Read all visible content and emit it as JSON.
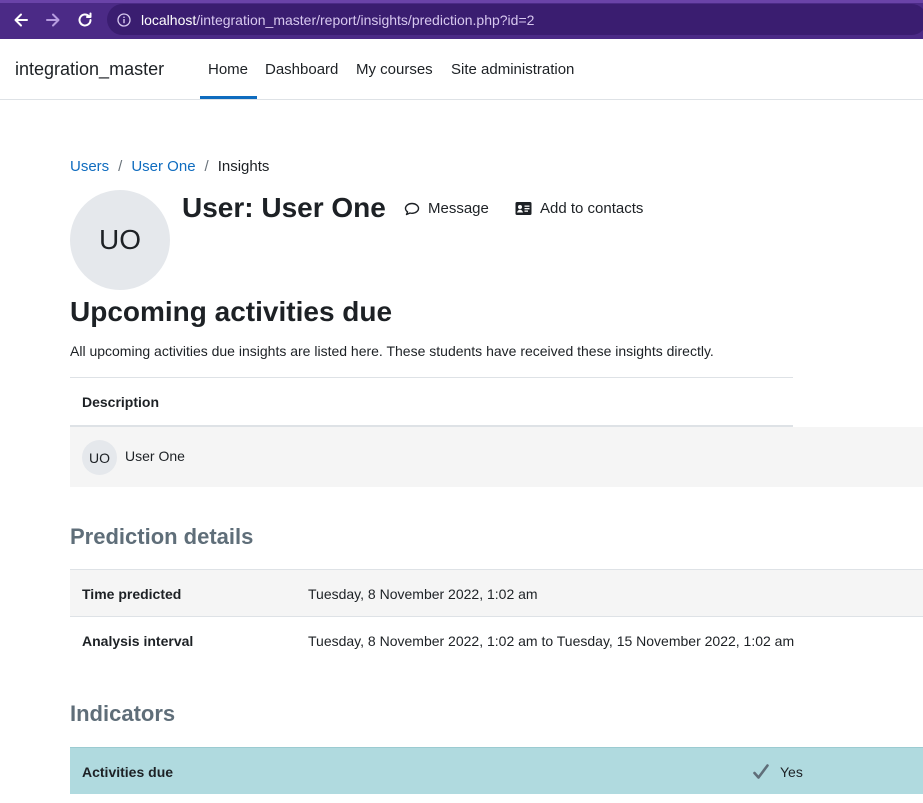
{
  "browser": {
    "url_host": "localhost",
    "url_path": "/integration_master/report/insights/prediction.php?id=2"
  },
  "navbar": {
    "site_name": "integration_master",
    "items": [
      {
        "label": "Home"
      },
      {
        "label": "Dashboard"
      },
      {
        "label": "My courses"
      },
      {
        "label": "Site administration"
      }
    ]
  },
  "breadcrumb": {
    "items": [
      {
        "label": "Users"
      },
      {
        "label": "User One"
      }
    ],
    "separator": "/",
    "current": "Insights"
  },
  "header": {
    "avatar_initials": "UO",
    "title": "User: User One",
    "message_label": "Message",
    "add_contacts_label": "Add to contacts"
  },
  "insight": {
    "title": "Upcoming activities due",
    "description": "All upcoming activities due insights are listed here. These students have received these insights directly.",
    "table_header": "Description",
    "row": {
      "avatar_initials": "UO",
      "user_name": "User One"
    }
  },
  "prediction_details": {
    "heading": "Prediction details",
    "rows": [
      {
        "label": "Time predicted",
        "value": "Tuesday, 8 November 2022, 1:02 am"
      },
      {
        "label": "Analysis interval",
        "value": "Tuesday, 8 November 2022, 1:02 am to Tuesday, 15 November 2022, 1:02 am"
      }
    ]
  },
  "indicators": {
    "heading": "Indicators",
    "rows": [
      {
        "label": "Activities due",
        "value": "Yes",
        "icon": "check-icon"
      }
    ]
  },
  "colors": {
    "browser_bar": "#4b2a86",
    "link": "#0f6cbf",
    "indicator_row": "#b0dadf",
    "subheading": "#5f6e79"
  }
}
